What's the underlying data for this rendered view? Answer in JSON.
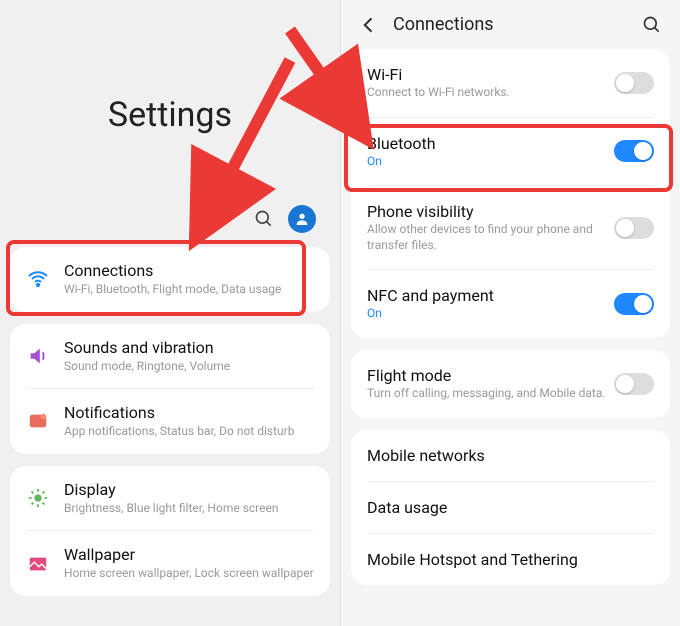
{
  "left": {
    "title": "Settings",
    "items": [
      {
        "icon": "wifi",
        "title": "Connections",
        "sub": "Wi-Fi, Bluetooth, Flight mode, Data usage",
        "highlight": true
      },
      {
        "icon": "sound",
        "title": "Sounds and vibration",
        "sub": "Sound mode, Ringtone, Volume"
      },
      {
        "icon": "notif",
        "title": "Notifications",
        "sub": "App notifications, Status bar, Do not disturb"
      },
      {
        "icon": "display",
        "title": "Display",
        "sub": "Brightness, Blue light filter, Home screen"
      },
      {
        "icon": "wallpaper",
        "title": "Wallpaper",
        "sub": "Home screen wallpaper, Lock screen wallpaper"
      }
    ]
  },
  "right": {
    "title": "Connections",
    "rows": [
      {
        "title": "Wi-Fi",
        "sub": "Connect to Wi-Fi networks.",
        "toggle": "off"
      },
      {
        "title": "Bluetooth",
        "sub": "On",
        "subOn": true,
        "toggle": "on",
        "highlight": true
      },
      {
        "title": "Phone visibility",
        "sub": "Allow other devices to find your phone and transfer files.",
        "toggle": "off"
      },
      {
        "title": "NFC and payment",
        "sub": "On",
        "subOn": true,
        "toggle": "on"
      },
      {
        "title": "Flight mode",
        "sub": "Turn off calling, messaging, and Mobile data.",
        "toggle": "off"
      },
      {
        "title": "Mobile networks"
      },
      {
        "title": "Data usage"
      },
      {
        "title": "Mobile Hotspot and Tethering"
      }
    ]
  }
}
